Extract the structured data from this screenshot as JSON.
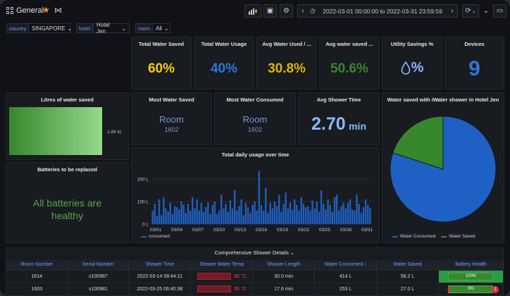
{
  "header": {
    "title": "General",
    "time_range": "2022-03-01 00:00:00 to 2022-03-31 23:59:59"
  },
  "variables": [
    {
      "label": "country",
      "value": "SINGAPORE"
    },
    {
      "label": "hotel",
      "value": "Hotel Jen"
    },
    {
      "label": "room",
      "value": "All"
    }
  ],
  "stats": {
    "total_water_saved": {
      "title": "Total Water Saved",
      "value": "60%",
      "color": "#f2cc0c"
    },
    "total_water_usage": {
      "title": "Total Water Usage",
      "value": "40%",
      "color": "#3274d9"
    },
    "avg_water_used": {
      "title": "Avg Water Used / ...",
      "value": "30.8%",
      "color": "#e0b400"
    },
    "avg_water_saved": {
      "title": "Avg water saved ...",
      "value": "50.6%",
      "color": "#37872d"
    },
    "utility_savings": {
      "title": "Utility Savings %",
      "value": "%",
      "icon": "water-drop-icon"
    },
    "devices": {
      "title": "Devices",
      "value": "9",
      "color": "#3274d9"
    }
  },
  "litres_saved": {
    "title": "Litres of water saved",
    "value": "1.89 kL",
    "fill": 0.88
  },
  "batteries": {
    "title": "Batteries to be replaced",
    "message": "All batteries are healthy"
  },
  "most_saved": {
    "title": "Most Water Saved",
    "room": "Room",
    "number": "1602"
  },
  "most_consumed": {
    "title": "Most Water Consumed",
    "room": "Room",
    "number": "1602"
  },
  "shower_time": {
    "title": "Avg Shower Time",
    "value": "2.70",
    "unit": "min"
  },
  "pie": {
    "title": "Water saved with iWater shower in Hotel Jen",
    "legend": [
      "Water Consumed",
      "Water Saved"
    ],
    "colors": [
      "#1f60c4",
      "#37872d"
    ]
  },
  "chart_data": [
    {
      "type": "bar",
      "title": "Total daily usage over time",
      "series_name": "consumed",
      "color": "#1f60c4",
      "ylim": [
        0,
        250
      ],
      "yticks": [
        "0 L",
        "100 L",
        "200 L"
      ],
      "ytick_values": [
        0,
        100,
        200
      ],
      "xticks": [
        "03/01",
        "03/04",
        "03/07",
        "03/10",
        "03/13",
        "03/16",
        "03/19",
        "03/22",
        "03/25",
        "03/28",
        "03/31"
      ],
      "values": [
        60,
        90,
        35,
        110,
        40,
        120,
        70,
        55,
        95,
        45,
        80,
        75,
        65,
        100,
        85,
        50,
        90,
        60,
        120,
        70,
        110,
        60,
        95,
        55,
        75,
        95,
        45,
        85,
        100,
        45,
        60,
        130,
        70,
        90,
        55,
        105,
        70,
        150,
        60,
        80,
        110,
        40,
        95,
        75,
        50,
        85,
        100,
        60,
        235,
        85,
        60,
        160,
        50,
        95,
        70,
        100,
        80,
        130,
        55,
        90,
        140,
        70,
        95,
        65,
        110,
        85,
        60,
        120,
        90,
        75,
        80,
        60,
        105,
        70,
        100,
        55,
        150,
        90,
        65,
        110,
        85,
        55,
        120,
        130,
        60,
        80,
        95,
        70,
        95,
        110,
        65,
        60,
        130,
        90,
        50,
        75,
        110,
        85,
        70
      ]
    },
    {
      "type": "pie",
      "title": "Water saved with iWater shower in Hotel Jen",
      "categories": [
        "Water Consumed",
        "Water Saved"
      ],
      "values": [
        80,
        20
      ]
    }
  ],
  "table": {
    "title": "Comprehensive Shower Details",
    "columns": [
      "Room Number",
      "Serial Number",
      "Shower Time",
      "Shower Water Temp",
      "Shower Length",
      "Water Consumed",
      "Water Saved",
      "Battery Health"
    ],
    "rows": [
      {
        "room": "1614",
        "serial": "s100987",
        "time": "2022-03-14 08:44:11",
        "temp": "35 °C",
        "length": "30.0 min",
        "consumed": "414 L",
        "saved": "58.2 L",
        "battery": "100%"
      },
      {
        "room": "1603",
        "serial": "s100981",
        "time": "2022-03-25 06:40:38",
        "temp": "35 °C",
        "length": "17.6 min",
        "consumed": "253 L",
        "saved": "27.0 L",
        "battery": "9%"
      }
    ],
    "badge": "1"
  }
}
